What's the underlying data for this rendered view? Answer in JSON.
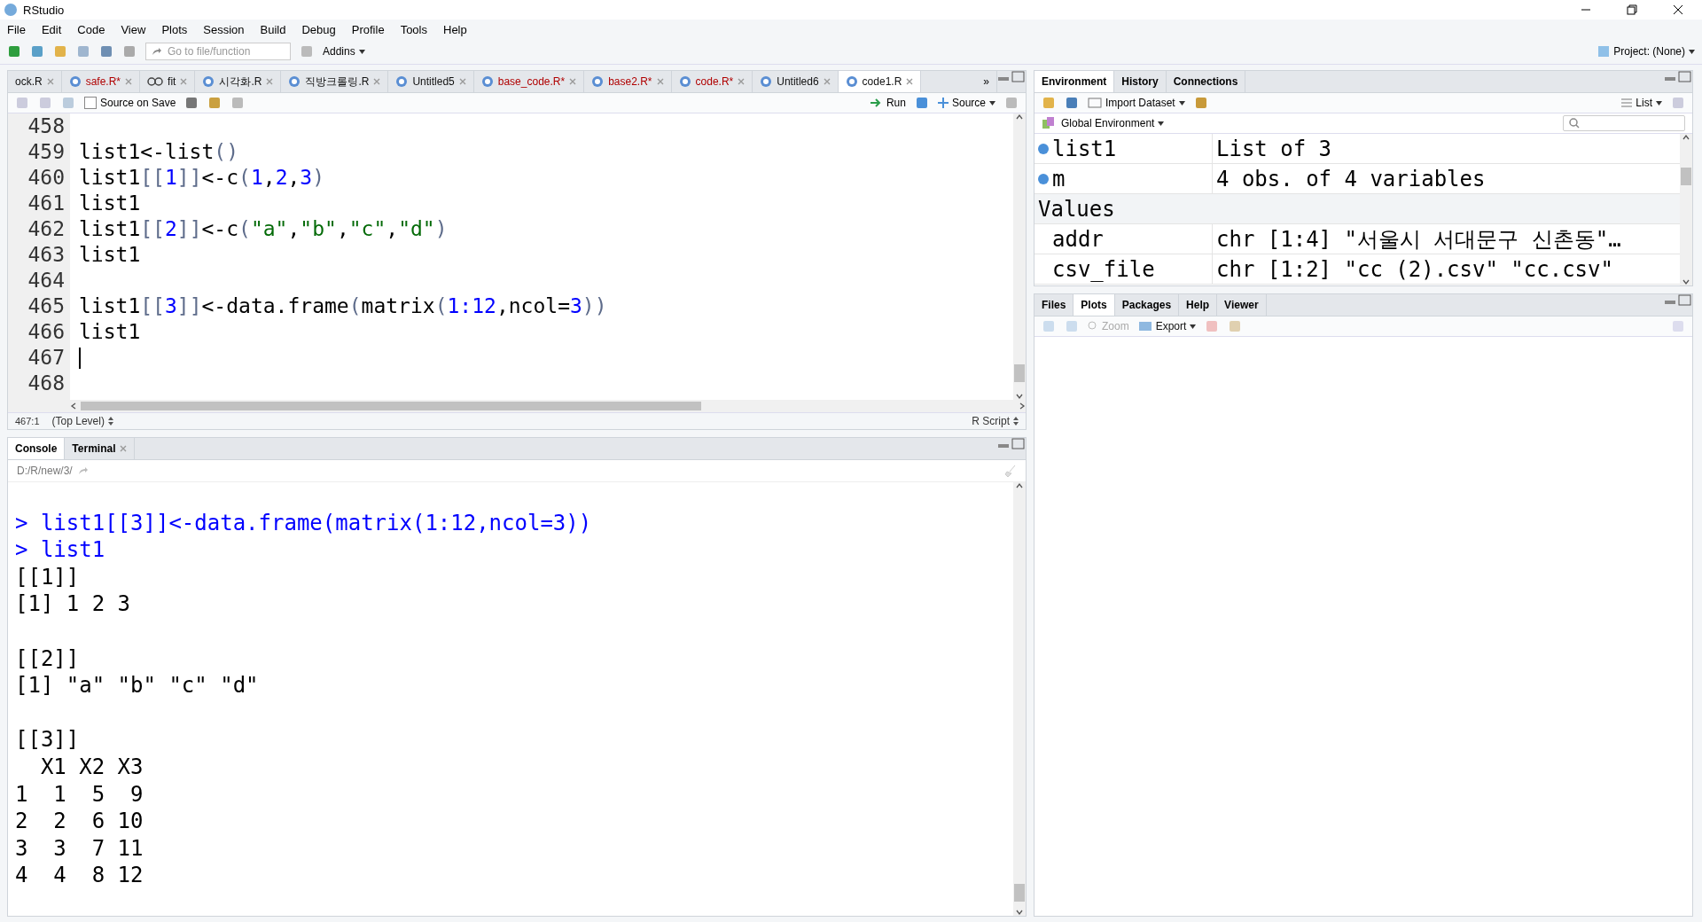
{
  "window": {
    "title": "RStudio"
  },
  "menu": [
    "File",
    "Edit",
    "Code",
    "View",
    "Plots",
    "Session",
    "Build",
    "Debug",
    "Profile",
    "Tools",
    "Help"
  ],
  "toolbar": {
    "goto_placeholder": "Go to file/function",
    "addins": "Addins",
    "project": "Project: (None)"
  },
  "editor": {
    "tabs": [
      {
        "label": "ock.R",
        "kind": "plain",
        "modified": false,
        "selected": false
      },
      {
        "label": "safe.R*",
        "kind": "script",
        "modified": true,
        "selected": false
      },
      {
        "label": "fit",
        "kind": "viewer",
        "modified": false,
        "selected": false
      },
      {
        "label": "시각화.R",
        "kind": "script",
        "modified": false,
        "selected": false
      },
      {
        "label": "직방크롤링.R",
        "kind": "script",
        "modified": false,
        "selected": false
      },
      {
        "label": "Untitled5",
        "kind": "script",
        "modified": false,
        "selected": false
      },
      {
        "label": "base_code.R*",
        "kind": "script",
        "modified": true,
        "selected": false
      },
      {
        "label": "base2.R*",
        "kind": "script",
        "modified": true,
        "selected": false
      },
      {
        "label": "code.R*",
        "kind": "script",
        "modified": true,
        "selected": false
      },
      {
        "label": "Untitled6",
        "kind": "script",
        "modified": false,
        "selected": false
      },
      {
        "label": "code1.R",
        "kind": "script",
        "modified": false,
        "selected": true
      }
    ],
    "overflow": "»",
    "source_on_save": {
      "label": "Source on Save",
      "checked": false
    },
    "run": "Run",
    "source": "Source",
    "lines": [
      {
        "number": "458"
      },
      {
        "number": "459",
        "tokens": [
          {
            "kind": "text",
            "s": "list1<-list"
          },
          {
            "kind": "bracket",
            "s": "()"
          }
        ]
      },
      {
        "number": "460",
        "tokens": [
          {
            "kind": "text",
            "s": "list1"
          },
          {
            "kind": "bracket",
            "s": "[["
          },
          {
            "kind": "number",
            "s": "1"
          },
          {
            "kind": "bracket",
            "s": "]]"
          },
          {
            "kind": "text",
            "s": "<-c"
          },
          {
            "kind": "bracket",
            "s": "("
          },
          {
            "kind": "number",
            "s": "1"
          },
          {
            "kind": "text",
            "s": ","
          },
          {
            "kind": "number",
            "s": "2"
          },
          {
            "kind": "text",
            "s": ","
          },
          {
            "kind": "number",
            "s": "3"
          },
          {
            "kind": "bracket",
            "s": ")"
          }
        ]
      },
      {
        "number": "461",
        "tokens": [
          {
            "kind": "text",
            "s": "list1"
          }
        ]
      },
      {
        "number": "462",
        "tokens": [
          {
            "kind": "text",
            "s": "list1"
          },
          {
            "kind": "bracket",
            "s": "[["
          },
          {
            "kind": "number",
            "s": "2"
          },
          {
            "kind": "bracket",
            "s": "]]"
          },
          {
            "kind": "text",
            "s": "<-c"
          },
          {
            "kind": "bracket",
            "s": "("
          },
          {
            "kind": "string",
            "s": "\"a\""
          },
          {
            "kind": "text",
            "s": ","
          },
          {
            "kind": "string",
            "s": "\"b\""
          },
          {
            "kind": "text",
            "s": ","
          },
          {
            "kind": "string",
            "s": "\"c\""
          },
          {
            "kind": "text",
            "s": ","
          },
          {
            "kind": "string",
            "s": "\"d\""
          },
          {
            "kind": "bracket",
            "s": ")"
          }
        ]
      },
      {
        "number": "463",
        "tokens": [
          {
            "kind": "text",
            "s": "list1"
          }
        ]
      },
      {
        "number": "464"
      },
      {
        "number": "465",
        "tokens": [
          {
            "kind": "text",
            "s": "list1"
          },
          {
            "kind": "bracket",
            "s": "[["
          },
          {
            "kind": "number",
            "s": "3"
          },
          {
            "kind": "bracket",
            "s": "]]"
          },
          {
            "kind": "text",
            "s": "<-data.frame"
          },
          {
            "kind": "bracket",
            "s": "("
          },
          {
            "kind": "text",
            "s": "matrix"
          },
          {
            "kind": "bracket",
            "s": "("
          },
          {
            "kind": "number",
            "s": "1:12"
          },
          {
            "kind": "text",
            "s": ",ncol="
          },
          {
            "kind": "number",
            "s": "3"
          },
          {
            "kind": "bracket",
            "s": "))"
          }
        ]
      },
      {
        "number": "466",
        "tokens": [
          {
            "kind": "text",
            "s": "list1"
          }
        ]
      },
      {
        "number": "467",
        "cursor": true
      },
      {
        "number": "468"
      }
    ],
    "status": {
      "position": "467:1",
      "scope": "(Top Level)",
      "type": "R Script"
    }
  },
  "console": {
    "tabs": [
      {
        "label": "Console",
        "selected": true
      },
      {
        "label": "Terminal",
        "selected": false
      }
    ],
    "path": "D:/R/new/3/",
    "lines": [
      {
        "kind": "blank"
      },
      {
        "kind": "input",
        "s": "> list1[[3]]<-data.frame(matrix(1:12,ncol=3))"
      },
      {
        "kind": "input",
        "s": "> list1"
      },
      {
        "kind": "output",
        "s": "[[1]]"
      },
      {
        "kind": "output",
        "s": "[1] 1 2 3"
      },
      {
        "kind": "blank"
      },
      {
        "kind": "output",
        "s": "[[2]]"
      },
      {
        "kind": "output",
        "s": "[1] \"a\" \"b\" \"c\" \"d\""
      },
      {
        "kind": "blank"
      },
      {
        "kind": "output",
        "s": "[[3]]"
      },
      {
        "kind": "output",
        "s": "  X1 X2 X3"
      },
      {
        "kind": "output",
        "s": "1  1  5  9"
      },
      {
        "kind": "output",
        "s": "2  2  6 10"
      },
      {
        "kind": "output",
        "s": "3  3  7 11"
      },
      {
        "kind": "output",
        "s": "4  4  8 12"
      }
    ]
  },
  "environment": {
    "tabs": [
      {
        "label": "Environment",
        "selected": true
      },
      {
        "label": "History",
        "selected": false
      },
      {
        "label": "Connections",
        "selected": false
      }
    ],
    "import": "Import Dataset",
    "view": "List",
    "scope": "Global Environment",
    "rows": [
      {
        "kind": "data",
        "name": "list1",
        "value": "List of 3"
      },
      {
        "kind": "data",
        "name": "m",
        "value": "4 obs. of 4 variables"
      },
      {
        "kind": "header",
        "name": "Values"
      },
      {
        "kind": "value",
        "name": "addr",
        "value": "chr [1:4] \"서울시 서대문구 신촌동\"…"
      },
      {
        "kind": "value",
        "name": "csv_file",
        "value": "chr [1:2] \"cc (2).csv\" \"cc.csv\""
      }
    ]
  },
  "files": {
    "tabs": [
      {
        "label": "Files",
        "selected": false
      },
      {
        "label": "Plots",
        "selected": true
      },
      {
        "label": "Packages",
        "selected": false
      },
      {
        "label": "Help",
        "selected": false
      },
      {
        "label": "Viewer",
        "selected": false
      }
    ],
    "zoom": "Zoom",
    "export": "Export"
  }
}
